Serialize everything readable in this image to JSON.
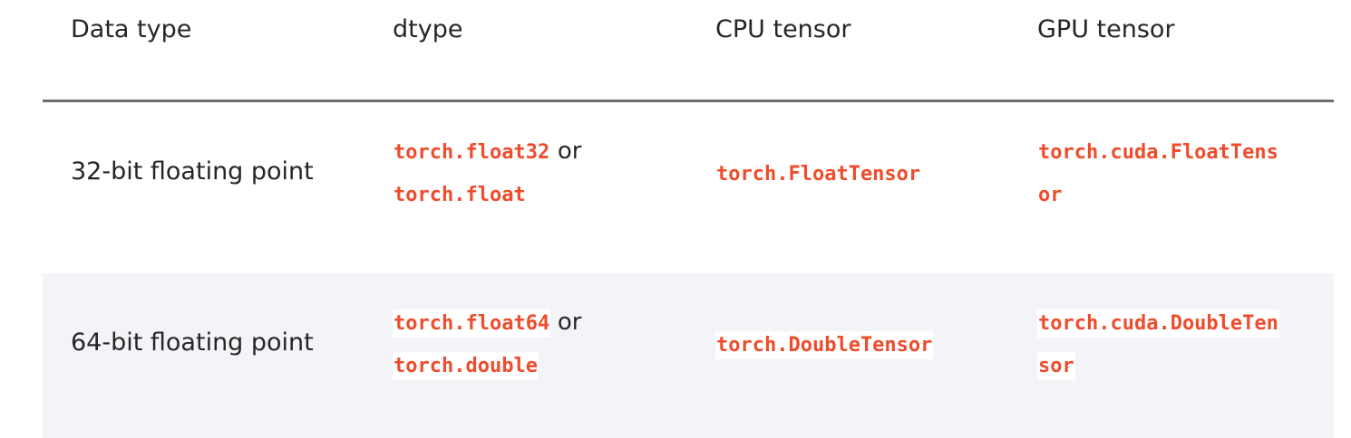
{
  "headers": {
    "data_type": "Data type",
    "dtype": "dtype",
    "cpu_tensor": "CPU tensor",
    "gpu_tensor": "GPU tensor"
  },
  "rows": [
    {
      "data_type": "32-bit floating point",
      "dtype_primary": "torch.float32",
      "dtype_connector": "or",
      "dtype_alias": "torch.float",
      "cpu_tensor": "torch.FloatTensor",
      "gpu_tensor_line1": "torch.cuda.FloatTens",
      "gpu_tensor_line2": "or"
    },
    {
      "data_type": "64-bit floating point",
      "dtype_primary": "torch.float64",
      "dtype_connector": "or",
      "dtype_alias": "torch.double",
      "cpu_tensor": "torch.DoubleTensor",
      "gpu_tensor_line1": "torch.cuda.DoubleTen",
      "gpu_tensor_line2": "sor"
    }
  ],
  "colors": {
    "code_text": "#ee4c2c",
    "body_text": "#262626",
    "header_rule": "#6c6c6d",
    "striped_row_bg": "#f3f4f7",
    "code_bg_on_striped": "#ffffff"
  }
}
